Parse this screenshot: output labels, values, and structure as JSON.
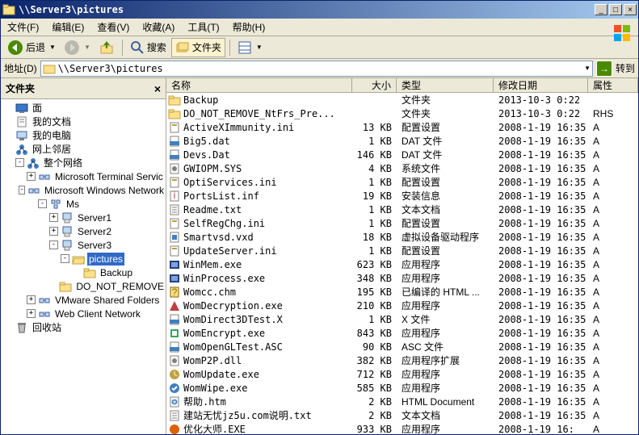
{
  "window": {
    "title": "\\\\Server3\\pictures"
  },
  "winbtns": {
    "min": "_",
    "max": "□",
    "close": "×"
  },
  "menu": {
    "file": "文件(F)",
    "edit": "编辑(E)",
    "view": "查看(V)",
    "fav": "收藏(A)",
    "tools": "工具(T)",
    "help": "帮助(H)"
  },
  "toolbar": {
    "back": "后退",
    "search": "搜索",
    "folders": "文件夹"
  },
  "addr": {
    "label": "地址(D)",
    "path": "\\\\Server3\\pictures",
    "go": "转到"
  },
  "sidebar": {
    "title": "文件夹",
    "items": [
      {
        "indent": 0,
        "tw": "",
        "icon": "desktop",
        "label": "面"
      },
      {
        "indent": 0,
        "tw": "",
        "icon": "mydocs",
        "label": "我的文档"
      },
      {
        "indent": 0,
        "tw": "",
        "icon": "mycomputer",
        "label": "我的电脑"
      },
      {
        "indent": 0,
        "tw": "",
        "icon": "network",
        "label": "网上邻居"
      },
      {
        "indent": 1,
        "tw": "-",
        "icon": "network",
        "label": "整个网络"
      },
      {
        "indent": 2,
        "tw": "+",
        "icon": "netprov",
        "label": "Microsoft Terminal Servic"
      },
      {
        "indent": 2,
        "tw": "-",
        "icon": "netprov",
        "label": "Microsoft Windows Network"
      },
      {
        "indent": 3,
        "tw": "-",
        "icon": "domain",
        "label": "Ms"
      },
      {
        "indent": 4,
        "tw": "+",
        "icon": "server",
        "label": "Server1"
      },
      {
        "indent": 4,
        "tw": "+",
        "icon": "server",
        "label": "Server2"
      },
      {
        "indent": 4,
        "tw": "-",
        "icon": "server",
        "label": "Server3"
      },
      {
        "indent": 5,
        "tw": "-",
        "icon": "folder-open",
        "label": "pictures",
        "sel": true
      },
      {
        "indent": 6,
        "tw": "",
        "icon": "folder",
        "label": "Backup"
      },
      {
        "indent": 6,
        "tw": "",
        "icon": "folder",
        "label": "DO_NOT_REMOVE"
      },
      {
        "indent": 2,
        "tw": "+",
        "icon": "netprov",
        "label": "VMware Shared Folders"
      },
      {
        "indent": 2,
        "tw": "+",
        "icon": "netprov",
        "label": "Web Client Network"
      },
      {
        "indent": 0,
        "tw": "",
        "icon": "recycle",
        "label": "回收站"
      }
    ]
  },
  "columns": {
    "name": "名称",
    "size": "大小",
    "type": "类型",
    "date": "修改日期",
    "attr": "属性"
  },
  "files": [
    {
      "icon": "folder",
      "name": "Backup",
      "size": "",
      "type": "文件夹",
      "date": "2013-10-3 0:22",
      "attr": ""
    },
    {
      "icon": "folder",
      "name": "DO_NOT_REMOVE_NtFrs_Pre...",
      "size": "",
      "type": "文件夹",
      "date": "2013-10-3 0:22",
      "attr": "RHS"
    },
    {
      "icon": "ini",
      "name": "ActiveXImmunity.ini",
      "size": "13 KB",
      "type": "配置设置",
      "date": "2008-1-19 16:35",
      "attr": "A"
    },
    {
      "icon": "dat",
      "name": "Big5.dat",
      "size": "1 KB",
      "type": "DAT 文件",
      "date": "2008-1-19 16:35",
      "attr": "A"
    },
    {
      "icon": "dat",
      "name": "Devs.Dat",
      "size": "146 KB",
      "type": "DAT 文件",
      "date": "2008-1-19 16:35",
      "attr": "A"
    },
    {
      "icon": "sys",
      "name": "GWIOPM.SYS",
      "size": "4 KB",
      "type": "系统文件",
      "date": "2008-1-19 16:35",
      "attr": "A"
    },
    {
      "icon": "ini",
      "name": "OptiServices.ini",
      "size": "1 KB",
      "type": "配置设置",
      "date": "2008-1-19 16:35",
      "attr": "A"
    },
    {
      "icon": "inf",
      "name": "PortsList.inf",
      "size": "19 KB",
      "type": "安装信息",
      "date": "2008-1-19 16:35",
      "attr": "A"
    },
    {
      "icon": "txt",
      "name": "Readme.txt",
      "size": "1 KB",
      "type": "文本文档",
      "date": "2008-1-19 16:35",
      "attr": "A"
    },
    {
      "icon": "ini",
      "name": "SelfRegChg.ini",
      "size": "1 KB",
      "type": "配置设置",
      "date": "2008-1-19 16:35",
      "attr": "A"
    },
    {
      "icon": "vxd",
      "name": "Smartvsd.vxd",
      "size": "18 KB",
      "type": "虚拟设备驱动程序",
      "date": "2008-1-19 16:35",
      "attr": "A"
    },
    {
      "icon": "ini",
      "name": "UpdateServer.ini",
      "size": "1 KB",
      "type": "配置设置",
      "date": "2008-1-19 16:35",
      "attr": "A"
    },
    {
      "icon": "exe1",
      "name": "WinMem.exe",
      "size": "623 KB",
      "type": "应用程序",
      "date": "2008-1-19 16:35",
      "attr": "A"
    },
    {
      "icon": "exe1",
      "name": "WinProcess.exe",
      "size": "348 KB",
      "type": "应用程序",
      "date": "2008-1-19 16:35",
      "attr": "A"
    },
    {
      "icon": "chm",
      "name": "Womcc.chm",
      "size": "195 KB",
      "type": "已编译的 HTML ...",
      "date": "2008-1-19 16:35",
      "attr": "A"
    },
    {
      "icon": "exe2",
      "name": "WomDecryption.exe",
      "size": "210 KB",
      "type": "应用程序",
      "date": "2008-1-19 16:35",
      "attr": "A"
    },
    {
      "icon": "x",
      "name": "WomDirect3DTest.X",
      "size": "1 KB",
      "type": "X 文件",
      "date": "2008-1-19 16:35",
      "attr": "A"
    },
    {
      "icon": "exe3",
      "name": "WomEncrypt.exe",
      "size": "843 KB",
      "type": "应用程序",
      "date": "2008-1-19 16:35",
      "attr": "A"
    },
    {
      "icon": "asc",
      "name": "WomOpenGLTest.ASC",
      "size": "90 KB",
      "type": "ASC 文件",
      "date": "2008-1-19 16:35",
      "attr": "A"
    },
    {
      "icon": "dll",
      "name": "WomP2P.dll",
      "size": "382 KB",
      "type": "应用程序扩展",
      "date": "2008-1-19 16:35",
      "attr": "A"
    },
    {
      "icon": "exe4",
      "name": "WomUpdate.exe",
      "size": "712 KB",
      "type": "应用程序",
      "date": "2008-1-19 16:35",
      "attr": "A"
    },
    {
      "icon": "exe5",
      "name": "WomWipe.exe",
      "size": "585 KB",
      "type": "应用程序",
      "date": "2008-1-19 16:35",
      "attr": "A"
    },
    {
      "icon": "htm",
      "name": "帮助.htm",
      "size": "2 KB",
      "type": "HTML Document",
      "date": "2008-1-19 16:35",
      "attr": "A"
    },
    {
      "icon": "txt",
      "name": "建站无忧jz5u.com说明.txt",
      "size": "2 KB",
      "type": "文本文档",
      "date": "2008-1-19 16:35",
      "attr": "A"
    },
    {
      "icon": "exe6",
      "name": "优化大师.EXE",
      "size": "933 KB",
      "type": "应用程序",
      "date": "2008-1-19 16:",
      "attr": "A"
    }
  ]
}
